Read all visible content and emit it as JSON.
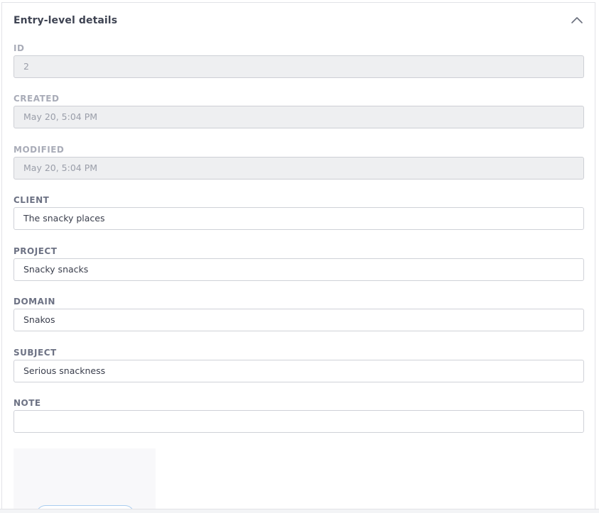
{
  "section": {
    "title": "Entry-level details",
    "collapse_icon": "chevron-up-icon"
  },
  "fields": {
    "id": {
      "label": "ID",
      "value": "2"
    },
    "created": {
      "label": "CREATED",
      "value": "May 20, 5:04 PM"
    },
    "modified": {
      "label": "MODIFIED",
      "value": "May 20, 5:04 PM"
    },
    "client": {
      "label": "CLIENT",
      "value": "The snacky places"
    },
    "project": {
      "label": "PROJECT",
      "value": "Snacky snacks"
    },
    "domain": {
      "label": "DOMAIN",
      "value": "Snakos"
    },
    "subject": {
      "label": "SUBJECT",
      "value": "Serious snackness"
    },
    "note": {
      "label": "NOTE",
      "value": ""
    }
  },
  "colors": {
    "label": "#6d7284",
    "label_disabled": "#a9acb8",
    "input_border": "#cfd1d8",
    "disabled_bg": "#eeeff1",
    "accent": "#a9cdef"
  }
}
